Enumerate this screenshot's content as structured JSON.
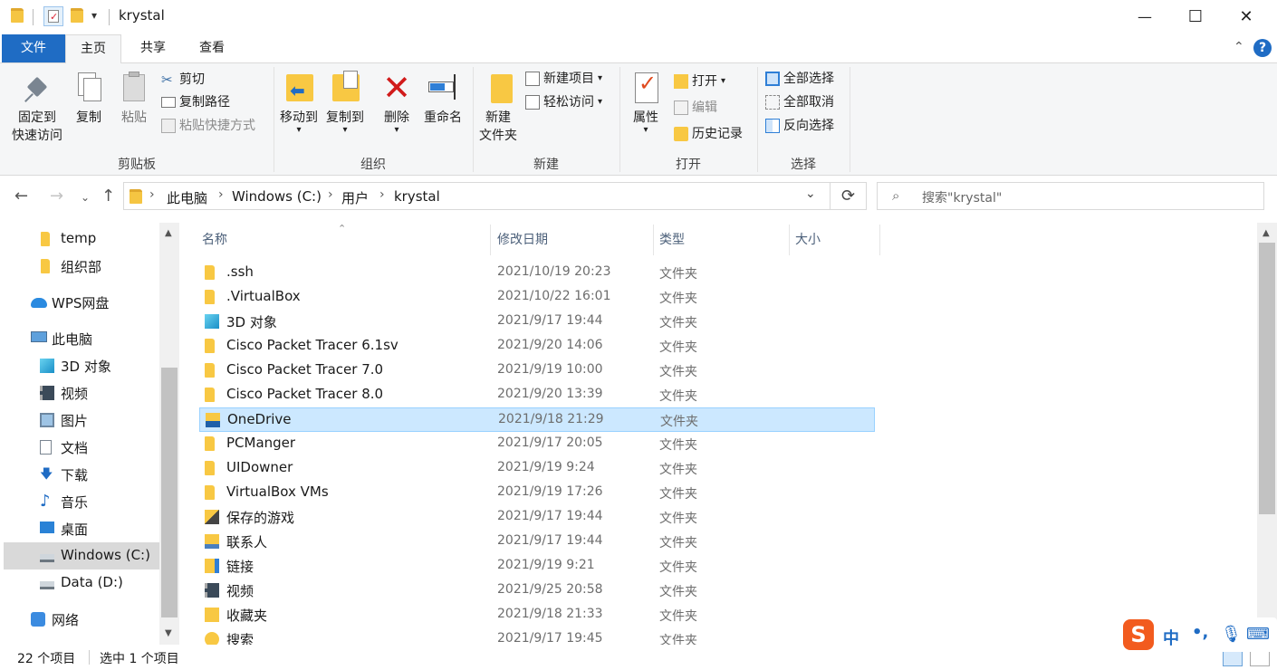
{
  "window": {
    "title": "krystal",
    "minimize": "—",
    "maximize": "☐",
    "close": "✕"
  },
  "tabs": {
    "file": "文件",
    "home": "主页",
    "share": "共享",
    "view": "查看"
  },
  "ribbon": {
    "clipboard": {
      "label": "剪贴板",
      "pin": "固定到\n快速访问",
      "pin_line1": "固定到",
      "pin_line2": "快速访问",
      "copy": "复制",
      "paste": "粘贴",
      "cut": "剪切",
      "copy_path": "复制路径",
      "paste_shortcut": "粘贴快捷方式"
    },
    "organize": {
      "label": "组织",
      "move_to": "移动到",
      "copy_to": "复制到",
      "delete": "删除",
      "rename": "重命名"
    },
    "new": {
      "label": "新建",
      "new_folder_line1": "新建",
      "new_folder_line2": "文件夹",
      "new_item": "新建项目",
      "easy_access": "轻松访问"
    },
    "open": {
      "label": "打开",
      "properties": "属性",
      "open": "打开",
      "edit": "编辑",
      "history": "历史记录"
    },
    "select": {
      "label": "选择",
      "select_all": "全部选择",
      "select_none": "全部取消",
      "invert": "反向选择"
    }
  },
  "address": {
    "crumbs": [
      "此电脑",
      "Windows (C:)",
      "用户",
      "krystal"
    ],
    "search_placeholder": "搜索\"krystal\""
  },
  "nav_pane": {
    "items": [
      {
        "label": "temp",
        "icon": "folder-icon"
      },
      {
        "label": "组织部",
        "icon": "folder-icon"
      },
      {
        "label": "WPS网盘",
        "icon": "cloud-icon"
      },
      {
        "label": "此电脑",
        "icon": "computer-icon"
      },
      {
        "label": "3D 对象",
        "icon": "cube-icon"
      },
      {
        "label": "视频",
        "icon": "video-icon"
      },
      {
        "label": "图片",
        "icon": "picture-icon"
      },
      {
        "label": "文档",
        "icon": "document-icon"
      },
      {
        "label": "下载",
        "icon": "download-icon"
      },
      {
        "label": "音乐",
        "icon": "music-icon"
      },
      {
        "label": "桌面",
        "icon": "desktop-icon"
      },
      {
        "label": "Windows (C:)",
        "icon": "drive-icon"
      },
      {
        "label": "Data (D:)",
        "icon": "drive-icon"
      },
      {
        "label": "网络",
        "icon": "network-icon"
      }
    ]
  },
  "file_list": {
    "columns": [
      "名称",
      "修改日期",
      "类型",
      "大小"
    ],
    "rows": [
      {
        "name": ".ssh",
        "date": "2021/10/19 20:23",
        "type": "文件夹",
        "icon": "folder-icon"
      },
      {
        "name": ".VirtualBox",
        "date": "2021/10/22 16:01",
        "type": "文件夹",
        "icon": "folder-icon"
      },
      {
        "name": "3D 对象",
        "date": "2021/9/17 19:44",
        "type": "文件夹",
        "icon": "cube-icon"
      },
      {
        "name": "Cisco Packet Tracer 6.1sv",
        "date": "2021/9/20 14:06",
        "type": "文件夹",
        "icon": "folder-icon"
      },
      {
        "name": "Cisco Packet Tracer 7.0",
        "date": "2021/9/19 10:00",
        "type": "文件夹",
        "icon": "folder-icon"
      },
      {
        "name": "Cisco Packet Tracer 8.0",
        "date": "2021/9/20 13:39",
        "type": "文件夹",
        "icon": "folder-icon"
      },
      {
        "name": "OneDrive",
        "date": "2021/9/18 21:29",
        "type": "文件夹",
        "icon": "onedrive-folder-icon"
      },
      {
        "name": "PCManger",
        "date": "2021/9/17 20:05",
        "type": "文件夹",
        "icon": "folder-icon"
      },
      {
        "name": "UIDowner",
        "date": "2021/9/19 9:24",
        "type": "文件夹",
        "icon": "folder-icon"
      },
      {
        "name": "VirtualBox VMs",
        "date": "2021/9/19 17:26",
        "type": "文件夹",
        "icon": "folder-icon"
      },
      {
        "name": "保存的游戏",
        "date": "2021/9/17 19:44",
        "type": "文件夹",
        "icon": "saved-games-icon"
      },
      {
        "name": "联系人",
        "date": "2021/9/17 19:44",
        "type": "文件夹",
        "icon": "contacts-icon"
      },
      {
        "name": "链接",
        "date": "2021/9/19 9:21",
        "type": "文件夹",
        "icon": "links-icon"
      },
      {
        "name": "视频",
        "date": "2021/9/25 20:58",
        "type": "文件夹",
        "icon": "video-icon"
      },
      {
        "name": "收藏夹",
        "date": "2021/9/18 21:33",
        "type": "文件夹",
        "icon": "favorites-icon"
      },
      {
        "name": "搜索",
        "date": "2021/9/17 19:45",
        "type": "文件夹",
        "icon": "search-folder-icon"
      }
    ]
  },
  "status": {
    "count": "22 个项目",
    "selected": "选中 1 个项目"
  },
  "ime": {
    "lang": "中",
    "punct": "•,"
  }
}
